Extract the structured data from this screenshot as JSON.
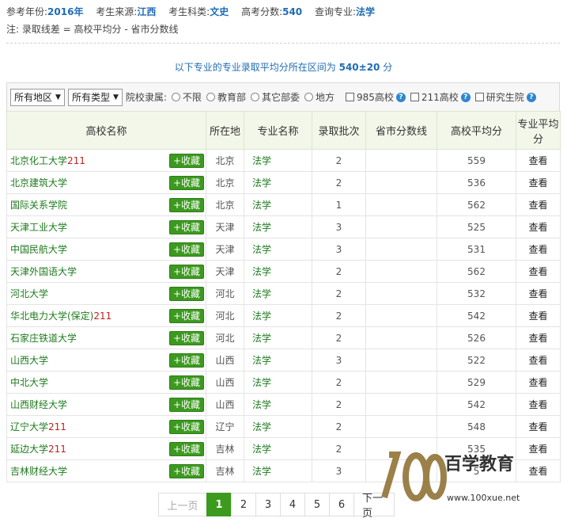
{
  "info": {
    "year_label": "参考年份:",
    "year": "2016年",
    "origin_label": "考生来源:",
    "origin": "江西",
    "subject_label": "考生科类:",
    "subject": "文史",
    "score_label": "高考分数:",
    "score": "540",
    "major_label": "查询专业:",
    "major": "法学"
  },
  "note": "注: 录取线差 = 高校平均分 - 省市分数线",
  "range": {
    "prefix": "以下专业的专业录取平均分所在区间为",
    "value": "540±20",
    "suffix": "分"
  },
  "filters": {
    "region": "所有地区",
    "type": "所有类型",
    "affiliation_label": "院校隶属:",
    "radios": [
      "不限",
      "教育部",
      "其它部委",
      "地方"
    ],
    "checks": [
      "985高校",
      "211高校",
      "研究生院"
    ]
  },
  "table": {
    "headers": [
      "高校名称",
      "所在地",
      "专业名称",
      "录取批次",
      "省市分数线",
      "高校平均分",
      "专业平均分"
    ],
    "fav_label": "+收藏",
    "view_label": "查看",
    "rows": [
      {
        "name": "北京化工大学",
        "tag": "211",
        "loc": "北京",
        "major": "法学",
        "batch": "2",
        "line": "",
        "avg": "559"
      },
      {
        "name": "北京建筑大学",
        "tag": "",
        "loc": "北京",
        "major": "法学",
        "batch": "2",
        "line": "",
        "avg": "536"
      },
      {
        "name": "国际关系学院",
        "tag": "",
        "loc": "北京",
        "major": "法学",
        "batch": "1",
        "line": "",
        "avg": "562"
      },
      {
        "name": "天津工业大学",
        "tag": "",
        "loc": "天津",
        "major": "法学",
        "batch": "3",
        "line": "",
        "avg": "525"
      },
      {
        "name": "中国民航大学",
        "tag": "",
        "loc": "天津",
        "major": "法学",
        "batch": "3",
        "line": "",
        "avg": "531"
      },
      {
        "name": "天津外国语大学",
        "tag": "",
        "loc": "天津",
        "major": "法学",
        "batch": "2",
        "line": "",
        "avg": "562"
      },
      {
        "name": "河北大学",
        "tag": "",
        "loc": "河北",
        "major": "法学",
        "batch": "2",
        "line": "",
        "avg": "532"
      },
      {
        "name": "华北电力大学(保定)",
        "tag": "211",
        "loc": "河北",
        "major": "法学",
        "batch": "2",
        "line": "",
        "avg": "542"
      },
      {
        "name": "石家庄铁道大学",
        "tag": "",
        "loc": "河北",
        "major": "法学",
        "batch": "2",
        "line": "",
        "avg": "526"
      },
      {
        "name": "山西大学",
        "tag": "",
        "loc": "山西",
        "major": "法学",
        "batch": "3",
        "line": "",
        "avg": "522"
      },
      {
        "name": "中北大学",
        "tag": "",
        "loc": "山西",
        "major": "法学",
        "batch": "2",
        "line": "",
        "avg": "529"
      },
      {
        "name": "山西财经大学",
        "tag": "",
        "loc": "山西",
        "major": "法学",
        "batch": "2",
        "line": "",
        "avg": "542"
      },
      {
        "name": "辽宁大学",
        "tag": "211",
        "loc": "辽宁",
        "major": "法学",
        "batch": "2",
        "line": "",
        "avg": "548"
      },
      {
        "name": "延边大学",
        "tag": "211",
        "loc": "吉林",
        "major": "法学",
        "batch": "2",
        "line": "",
        "avg": "535"
      },
      {
        "name": "吉林财经大学",
        "tag": "",
        "loc": "吉林",
        "major": "法学",
        "batch": "3",
        "line": "",
        "avg": "5"
      }
    ]
  },
  "pager": {
    "prev": "上一页",
    "pages": [
      "1",
      "2",
      "3",
      "4",
      "5",
      "6"
    ],
    "current": "1",
    "next": "下一页"
  },
  "watermark": {
    "brand": "百学教育",
    "url": "www.100xue.net"
  },
  "colors": {
    "accent_green": "#3c9a1f",
    "link_blue": "#1f6bb5",
    "tag_red": "#c02020",
    "header_bg": "#f3f7ea"
  }
}
